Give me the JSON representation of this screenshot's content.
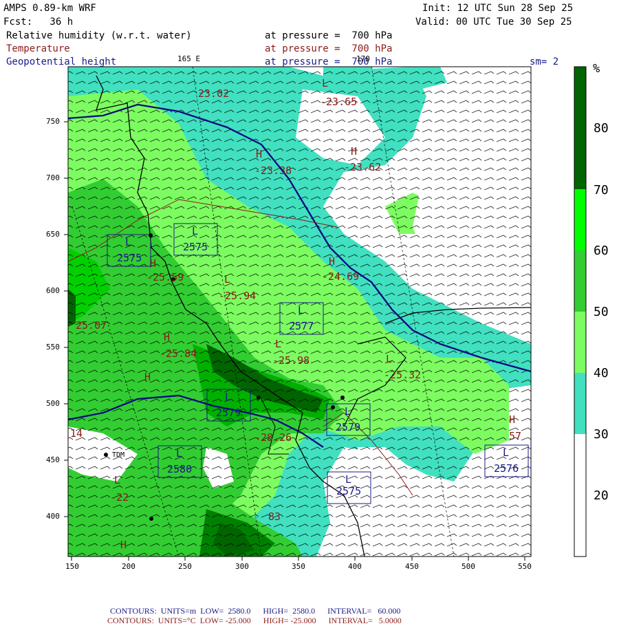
{
  "header": {
    "model": "AMPS 0.89-km WRF",
    "init": "Init: 12 UTC Sun 28 Sep 25",
    "fcst": "Fcst:   36 h",
    "valid": "Valid: 00 UTC Tue 30 Sep 25",
    "line1_var": "Relative humidity (w.r.t. water)",
    "line1_level": "at pressure =  700 hPa",
    "line2_var": "Temperature",
    "line2_level": "at pressure =  700 hPa",
    "line3_var": "Geopotential height",
    "line3_level": "at pressure =  700 hPa",
    "sm": "sm= 2",
    "lon_label_1": "165 E",
    "lon_label_2": "170"
  },
  "colorbar": {
    "unit": "%",
    "labels": [
      "80",
      "70",
      "60",
      "50",
      "40",
      "30",
      "20"
    ],
    "colors": [
      "#006400",
      "#008000",
      "#00ff00",
      "#32cd32",
      "#7cfc60",
      "#40e0c0",
      "#ffffff"
    ]
  },
  "axes": {
    "x_ticks": [
      "150",
      "200",
      "250",
      "300",
      "350",
      "400",
      "450",
      "500",
      "550"
    ],
    "y_ticks": [
      "750",
      "700",
      "650",
      "600",
      "550",
      "500",
      "450",
      "400"
    ]
  },
  "map_labels": {
    "temps": [
      "23.02",
      "-23.65",
      "-23.38",
      "-23.62",
      "-25.59",
      "-25.94",
      "-24.69",
      "25.07",
      "-25.84",
      "-25.98",
      "-25.32",
      "-28.26",
      "14",
      "57",
      "-22",
      "83"
    ],
    "heights": [
      "2575",
      "2575",
      "2577",
      "2579",
      "2579",
      "2580",
      "2576",
      "2575"
    ],
    "H": "H",
    "L": "L",
    "station": "TDM"
  },
  "footer": {
    "row1": {
      "label": "CONTOURS:",
      "units": "UNITS=m",
      "low": "LOW=  2580.0",
      "high": "HIGH=  2580.0",
      "interval": "INTERVAL=   60.000"
    },
    "row2": {
      "label": "CONTOURS:",
      "units": "UNITS=°C",
      "low": "LOW= -25.000",
      "high": "HIGH= -25.000",
      "interval": "INTERVAL=   5.0000"
    }
  }
}
